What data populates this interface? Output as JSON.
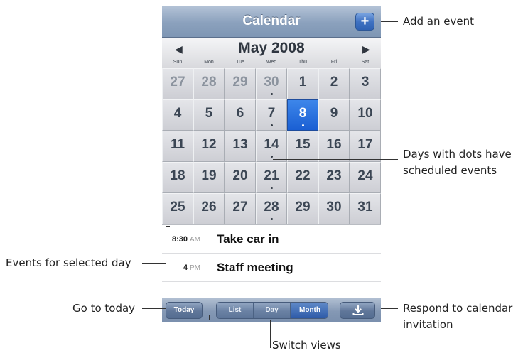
{
  "titlebar": {
    "title": "Calendar",
    "add_label": "+"
  },
  "month": {
    "title": "May 2008",
    "prev_arrow": "◀",
    "next_arrow": "▶",
    "weekdays": [
      "Sun",
      "Mon",
      "Tue",
      "Wed",
      "Thu",
      "Fri",
      "Sat"
    ]
  },
  "days": [
    {
      "n": "27",
      "other": true
    },
    {
      "n": "28",
      "other": true
    },
    {
      "n": "29",
      "other": true
    },
    {
      "n": "30",
      "other": true,
      "dot": true
    },
    {
      "n": "1"
    },
    {
      "n": "2"
    },
    {
      "n": "3"
    },
    {
      "n": "4"
    },
    {
      "n": "5"
    },
    {
      "n": "6"
    },
    {
      "n": "7",
      "dot": true
    },
    {
      "n": "8",
      "dot": true,
      "selected": true
    },
    {
      "n": "9"
    },
    {
      "n": "10"
    },
    {
      "n": "11"
    },
    {
      "n": "12"
    },
    {
      "n": "13"
    },
    {
      "n": "14",
      "dot": true
    },
    {
      "n": "15"
    },
    {
      "n": "16"
    },
    {
      "n": "17"
    },
    {
      "n": "18"
    },
    {
      "n": "19"
    },
    {
      "n": "20"
    },
    {
      "n": "21",
      "dot": true
    },
    {
      "n": "22"
    },
    {
      "n": "23"
    },
    {
      "n": "24"
    },
    {
      "n": "25"
    },
    {
      "n": "26"
    },
    {
      "n": "27"
    },
    {
      "n": "28",
      "dot": true
    },
    {
      "n": "29"
    },
    {
      "n": "30"
    },
    {
      "n": "31"
    }
  ],
  "events": [
    {
      "time": "8:30",
      "ampm": "AM",
      "title": "Take car in"
    },
    {
      "time": "4",
      "ampm": "PM",
      "title": "Staff meeting"
    }
  ],
  "toolbar": {
    "today": "Today",
    "views": [
      "List",
      "Day",
      "Month"
    ],
    "active_view": "Month",
    "respond_icon": "download-arrow-icon"
  },
  "callouts": {
    "add_event": "Add an event",
    "days_dots_1": "Days with dots have",
    "days_dots_2": "scheduled events",
    "events_selected": "Events for selected day",
    "go_today": "Go to today",
    "respond_1": "Respond to calendar",
    "respond_2": "invitation",
    "switch_views": "Switch views"
  },
  "colors": {
    "selected_day": "#1a5fd3",
    "titlebar": "#8ba1bd",
    "toolbar": "#8498b4"
  }
}
